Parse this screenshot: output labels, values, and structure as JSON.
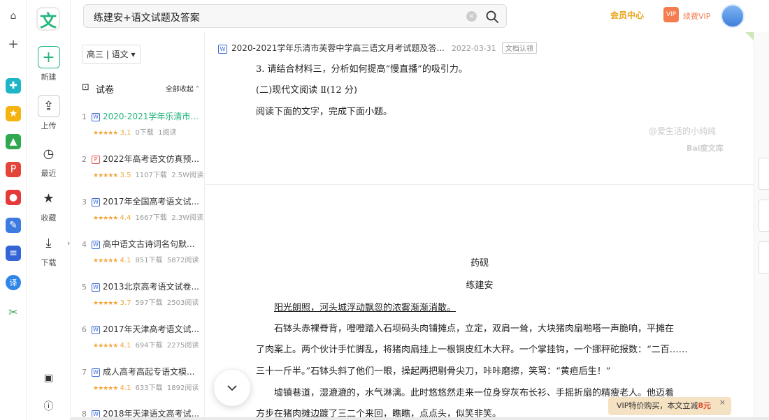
{
  "search": {
    "query": "练建安+语文试题及答案"
  },
  "header": {
    "member_center": "会员中心",
    "vip_badge": "VIP",
    "renew_vip": "续费VIP"
  },
  "tools": {
    "logo": "文",
    "new": "新建",
    "upload": "上传",
    "recent": "最近",
    "favorites": "收藏",
    "download": "下载"
  },
  "filter": {
    "label": "高三 | 语文"
  },
  "section": {
    "title": "试卷",
    "collapse": "全部收起"
  },
  "docs": [
    {
      "num": "1",
      "type": "W",
      "title": "2020-2021学年乐清市...",
      "stars": "★★★★★",
      "score": "3.1",
      "downloads": "0下载",
      "reads": "1阅读"
    },
    {
      "num": "2",
      "type": "P",
      "title": "2022年高考语文仿真预...",
      "stars": "★★★★★",
      "score": "3.5",
      "downloads": "1107下载",
      "reads": "2.5W阅读"
    },
    {
      "num": "3",
      "type": "W",
      "title": "2017年全国高考语文试...",
      "stars": "★★★★★",
      "score": "4.4",
      "downloads": "1667下载",
      "reads": "2.3W阅读"
    },
    {
      "num": "4",
      "type": "W",
      "title": "高中语文古诗词名句默...",
      "stars": "★★★★★",
      "score": "4.1",
      "downloads": "851下载",
      "reads": "5872阅读"
    },
    {
      "num": "5",
      "type": "W",
      "title": "2013北京高考语文试卷...",
      "stars": "★★★★★",
      "score": "3.7",
      "downloads": "597下载",
      "reads": "2503阅读"
    },
    {
      "num": "6",
      "type": "W",
      "title": "2017年天津高考语文试...",
      "stars": "★★★★★",
      "score": "4.1",
      "downloads": "694下载",
      "reads": "2275阅读"
    },
    {
      "num": "7",
      "type": "W",
      "title": "成人高考高起专语文模...",
      "stars": "★★★★★",
      "score": "4.1",
      "downloads": "633下载",
      "reads": "1892阅读"
    },
    {
      "num": "8",
      "type": "W",
      "title": "2018年天津语文高考试...",
      "stars": "",
      "score": "",
      "downloads": "",
      "reads": ""
    }
  ],
  "viewer": {
    "doc_title": "2020-2021学年乐清市芙蓉中学高三语文月考试题及答...",
    "doc_date": "2022-03-31",
    "claim": "文档认领",
    "line1": "3. 请结合材料三，分析如何提高“慢直播”的吸引力。",
    "line2": "(二)现代文阅读 Ⅱ(12 分)",
    "line3": "阅读下面的文字，完成下面小题。",
    "watermark_user": "@爱生活的小纯纯",
    "watermark_brand": "Bai度文库",
    "story_title": "药砚",
    "story_author": "练建安",
    "para1": "阳光朗照，河头城浮动飘忽的浓雾渐渐消散。",
    "para2": "石钵头赤裸脊背，噔噔踏入石坝码头肉铺摊点，立定，双肩一耸，大块猪肉扇啪嗒一声脆响，平摊在",
    "para3": "了肉案上。两个伙计手忙脚乱，将猪肉扇挂上一根铜皮红木大秤。一个掌挂钩，一个挪秤砣报数：“二百……",
    "para4": "三十一斤半。”石钵头斜了他们一眼，操起两把剔骨尖刀，咔咔磨擦，笑骂：“黄疸后生！”",
    "para5": "墟镇巷道，湿漉漉的，水气淋漓。此时悠悠然走来一位身穿灰布长衫、手摇折扇的精瘦老人。他迈着",
    "para6": "方步在猪肉摊边踱了三二个来回，瞧瞧，点点头，似笑非笑。"
  },
  "promo": {
    "text": "VIP特价购买，本文立减",
    "price": "8元"
  },
  "colors": {
    "accent": "#21b67a",
    "vip": "#e8a317",
    "star": "#f3a53c"
  }
}
